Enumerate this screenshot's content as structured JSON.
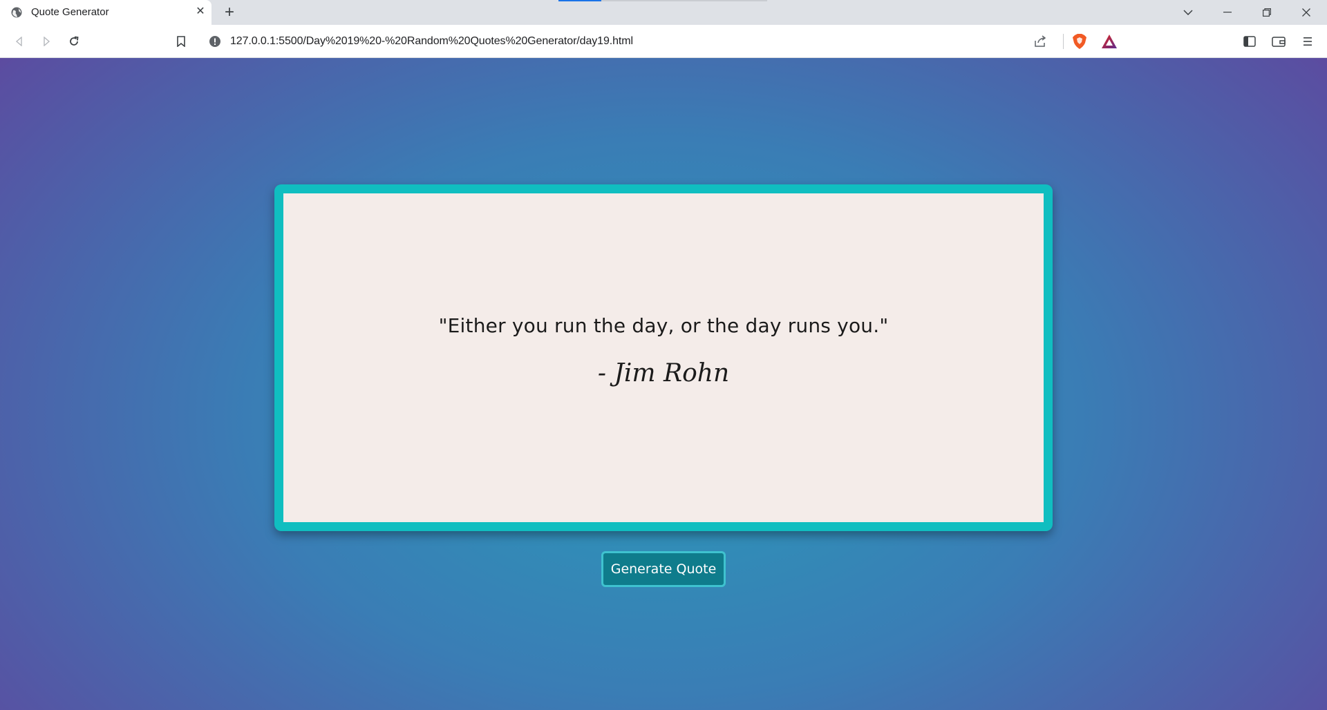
{
  "browser": {
    "tab_title": "Quote Generator",
    "tab_close_glyph": "✕",
    "new_tab_glyph": "+",
    "url": "127.0.0.1:5500/Day%2019%20-%20Random%20Quotes%20Generator/day19.html"
  },
  "page": {
    "quote": "\"Either you run the day, or the day runs you.\"",
    "author": "- Jim Rohn",
    "button_label": "Generate Quote"
  },
  "colors": {
    "card_border": "#10bec0",
    "card_background": "#f4ece9",
    "button_background": "#0f7c8c"
  }
}
